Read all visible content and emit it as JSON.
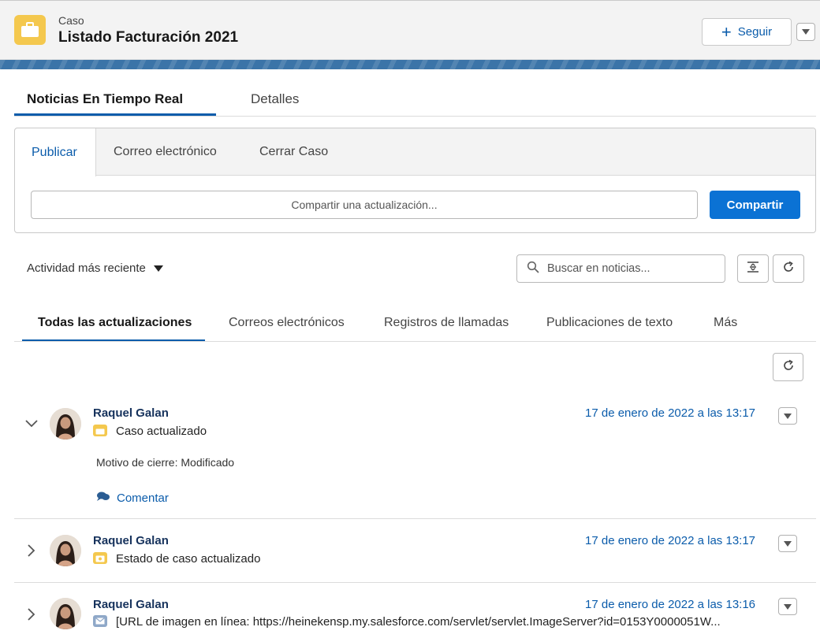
{
  "header": {
    "kicker": "Caso",
    "title": "Listado Facturación 2021",
    "follow_label": "Seguir",
    "icon": "briefcase-icon",
    "accent": "#f4c84e"
  },
  "primary_tabs": [
    {
      "label": "Noticias En Tiempo Real",
      "active": true
    },
    {
      "label": "Detalles",
      "active": false
    }
  ],
  "publisher": {
    "tabs": [
      {
        "label": "Publicar",
        "active": true
      },
      {
        "label": "Correo electrónico",
        "active": false
      },
      {
        "label": "Cerrar Caso",
        "active": false
      }
    ],
    "input_placeholder": "Compartir una actualización...",
    "share_label": "Compartir"
  },
  "feed_controls": {
    "sort_label": "Actividad más reciente",
    "search_placeholder": "Buscar en noticias..."
  },
  "filter_tabs": [
    {
      "label": "Todas las actualizaciones",
      "active": true
    },
    {
      "label": "Correos electrónicos",
      "active": false
    },
    {
      "label": "Registros de llamadas",
      "active": false
    },
    {
      "label": "Publicaciones de texto",
      "active": false
    },
    {
      "label": "Más",
      "active": false
    }
  ],
  "feed": [
    {
      "author": "Raquel Galan",
      "action": "Caso actualizado",
      "timestamp": "17 de enero de 2022 a las 13:17",
      "icon": "case-icon",
      "expanded": true,
      "field_label": "Motivo de cierre:",
      "field_value": "Modificado",
      "comment_label": "Comentar"
    },
    {
      "author": "Raquel Galan",
      "action": "Estado de caso actualizado",
      "timestamp": "17 de enero de 2022 a las 13:17",
      "icon": "case-status-icon",
      "expanded": false
    },
    {
      "author": "Raquel Galan",
      "action": "[URL de imagen en línea: https://heinekensp.my.salesforce.com/servlet/servlet.ImageServer?id=0153Y0000051W...",
      "timestamp": "17 de enero de 2022 a las 13:16",
      "icon": "email-icon",
      "expanded": false
    }
  ],
  "colors": {
    "brand": "#0b5cab",
    "share_button": "#0b72d4",
    "author": "#16325c"
  }
}
